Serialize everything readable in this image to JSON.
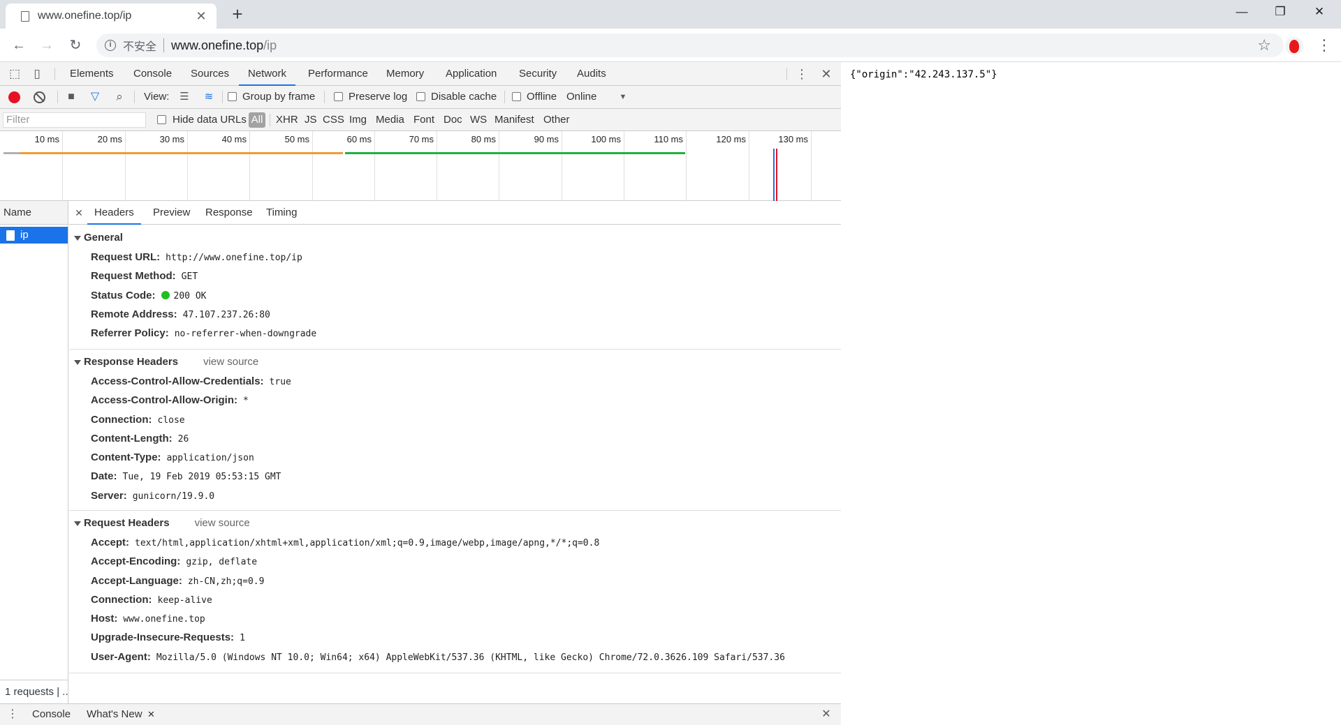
{
  "browser": {
    "tab_title": "www.onefine.top/ip",
    "insecure_label": "不安全",
    "url_host": "www.onefine.top",
    "url_path": "/ip"
  },
  "devtools": {
    "panels": [
      "Elements",
      "Console",
      "Sources",
      "Network",
      "Performance",
      "Memory",
      "Application",
      "Security",
      "Audits"
    ],
    "active_panel": "Network",
    "toolbar": {
      "view_label": "View:",
      "group_by_frame": "Group by frame",
      "preserve_log": "Preserve log",
      "disable_cache": "Disable cache",
      "offline": "Offline",
      "throttling": "Online"
    },
    "filter": {
      "placeholder": "Filter",
      "hide_data_urls": "Hide data URLs",
      "types": [
        "All",
        "XHR",
        "JS",
        "CSS",
        "Img",
        "Media",
        "Font",
        "Doc",
        "WS",
        "Manifest",
        "Other"
      ]
    },
    "timeline_ticks": [
      "10 ms",
      "20 ms",
      "30 ms",
      "40 ms",
      "50 ms",
      "60 ms",
      "70 ms",
      "80 ms",
      "90 ms",
      "100 ms",
      "110 ms",
      "120 ms",
      "130 ms"
    ],
    "name_header": "Name",
    "requests": [
      {
        "name": "ip"
      }
    ],
    "summary": "1 requests | ...",
    "detail_tabs": [
      "Headers",
      "Preview",
      "Response",
      "Timing"
    ],
    "general": {
      "title": "General",
      "rows": [
        {
          "key": "Request URL:",
          "value": "http://www.onefine.top/ip"
        },
        {
          "key": "Request Method:",
          "value": "GET"
        },
        {
          "key": "Status Code:",
          "value": "200 OK"
        },
        {
          "key": "Remote Address:",
          "value": "47.107.237.26:80"
        },
        {
          "key": "Referrer Policy:",
          "value": "no-referrer-when-downgrade"
        }
      ]
    },
    "response_headers": {
      "title": "Response Headers",
      "view_source": "view source",
      "rows": [
        {
          "key": "Access-Control-Allow-Credentials:",
          "value": "true"
        },
        {
          "key": "Access-Control-Allow-Origin:",
          "value": "*"
        },
        {
          "key": "Connection:",
          "value": "close"
        },
        {
          "key": "Content-Length:",
          "value": "26"
        },
        {
          "key": "Content-Type:",
          "value": "application/json"
        },
        {
          "key": "Date:",
          "value": "Tue, 19 Feb 2019 05:53:15 GMT"
        },
        {
          "key": "Server:",
          "value": "gunicorn/19.9.0"
        }
      ]
    },
    "request_headers": {
      "title": "Request Headers",
      "view_source": "view source",
      "rows": [
        {
          "key": "Accept:",
          "value": "text/html,application/xhtml+xml,application/xml;q=0.9,image/webp,image/apng,*/*;q=0.8"
        },
        {
          "key": "Accept-Encoding:",
          "value": "gzip, deflate"
        },
        {
          "key": "Accept-Language:",
          "value": "zh-CN,zh;q=0.9"
        },
        {
          "key": "Connection:",
          "value": "keep-alive"
        },
        {
          "key": "Host:",
          "value": "www.onefine.top"
        },
        {
          "key": "Upgrade-Insecure-Requests:",
          "value": "1"
        },
        {
          "key": "User-Agent:",
          "value": "Mozilla/5.0 (Windows NT 10.0; Win64; x64) AppleWebKit/537.36 (KHTML, like Gecko) Chrome/72.0.3626.109 Safari/537.36"
        }
      ]
    },
    "drawer_tabs": [
      "Console",
      "What's New"
    ]
  },
  "page_body": "{\"origin\":\"42.243.137.5\"}",
  "colors": {
    "accent": "#1a73e8",
    "record": "#e81123",
    "status_ok": "#20c020",
    "waterfall_waiting": "#f29b30",
    "waterfall_download": "#20b040",
    "waterfall_dom": "#1a73e8"
  }
}
